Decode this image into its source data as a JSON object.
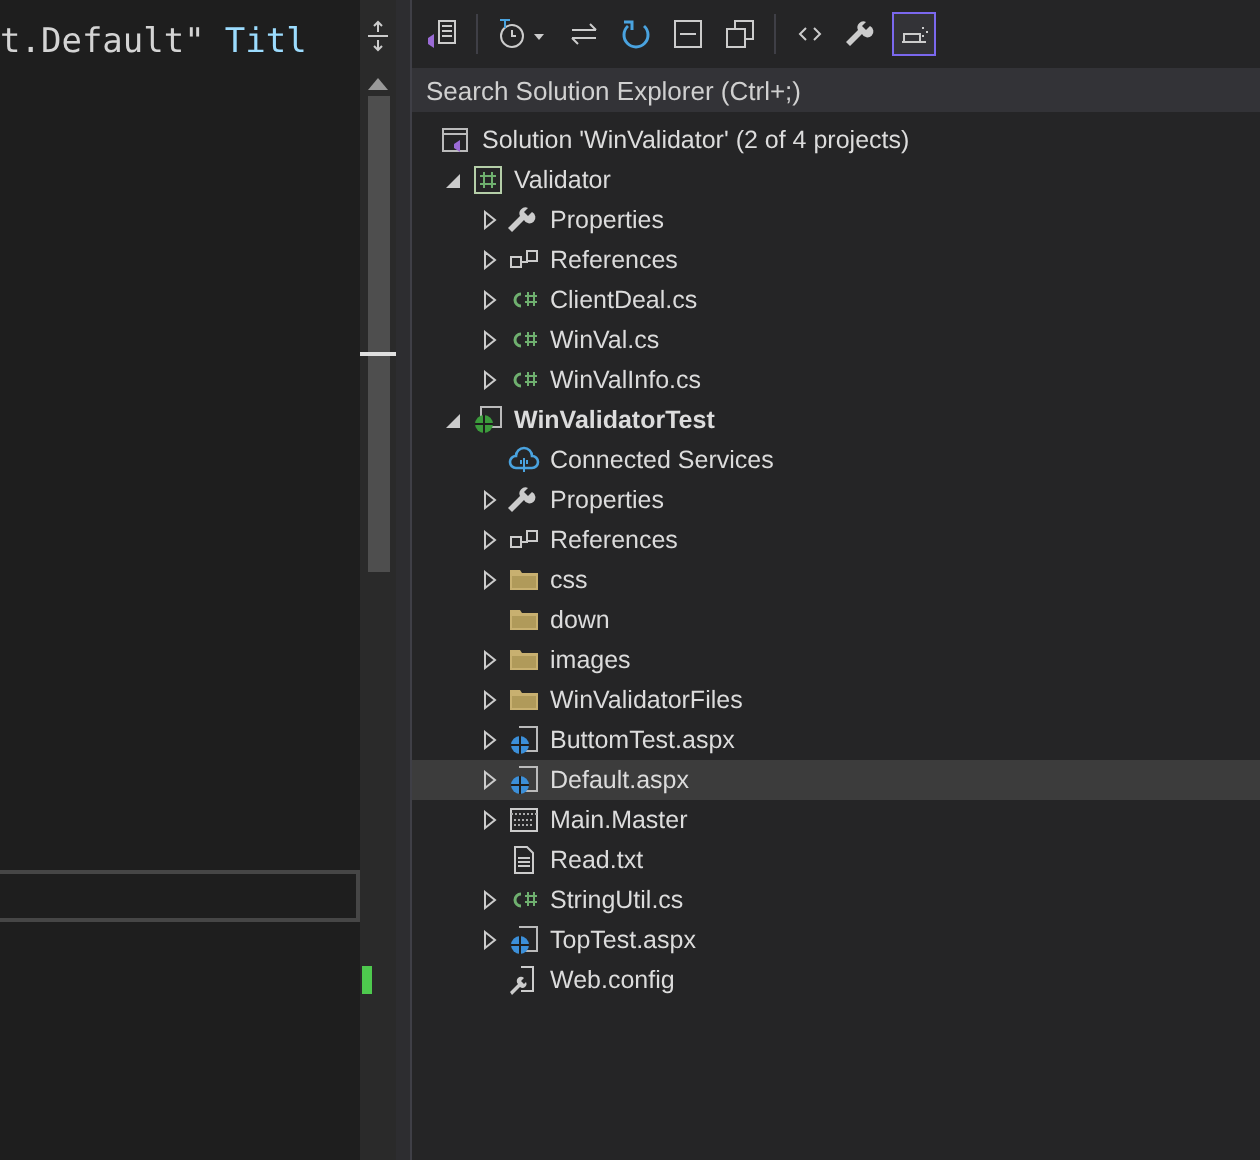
{
  "editor": {
    "code_line": [
      {
        "kind": "plain",
        "text": "t.Default\""
      },
      {
        "kind": "attribute",
        "text": "Titl"
      }
    ]
  },
  "solution_explorer": {
    "search": {
      "placeholder": "Search Solution Explorer (Ctrl+;)"
    },
    "toolbar": [
      {
        "kind": "home",
        "selected": false
      },
      {
        "kind": "history",
        "selected": false
      },
      {
        "kind": "sync",
        "selected": false
      },
      {
        "kind": "refresh",
        "selected": false
      },
      {
        "kind": "collapse",
        "selected": false
      },
      {
        "kind": "copies",
        "selected": false
      },
      {
        "kind": "code",
        "selected": false
      },
      {
        "kind": "wrench",
        "selected": false
      },
      {
        "kind": "preview",
        "selected": true
      }
    ],
    "tree": [
      {
        "label": "Solution 'WinValidator' (2 of 4 projects)",
        "kind": "solution",
        "selected": false,
        "bold": false,
        "children": [
          {
            "label": "Validator",
            "kind": "csproject",
            "expanded": true,
            "selected": false,
            "bold": false,
            "children": [
              {
                "label": "Properties",
                "kind": "wrench",
                "expanded": false,
                "selected": false,
                "bold": false
              },
              {
                "label": "References",
                "kind": "references",
                "expanded": false,
                "selected": false,
                "bold": false
              },
              {
                "label": "ClientDeal.cs",
                "kind": "csharp",
                "expanded": false,
                "selected": false,
                "bold": false
              },
              {
                "label": "WinVal.cs",
                "kind": "csharp",
                "expanded": false,
                "selected": false,
                "bold": false
              },
              {
                "label": "WinValInfo.cs",
                "kind": "csharp",
                "expanded": false,
                "selected": false,
                "bold": false
              }
            ]
          },
          {
            "label": "WinValidatorTest",
            "kind": "webproject",
            "expanded": true,
            "selected": false,
            "bold": true,
            "children": [
              {
                "label": "Connected Services",
                "kind": "connected",
                "selected": false,
                "bold": false
              },
              {
                "label": "Properties",
                "kind": "wrench",
                "expanded": false,
                "selected": false,
                "bold": false
              },
              {
                "label": "References",
                "kind": "references",
                "expanded": false,
                "selected": false,
                "bold": false
              },
              {
                "label": "css",
                "kind": "folder",
                "expanded": false,
                "selected": false,
                "bold": false
              },
              {
                "label": "down",
                "kind": "folder",
                "selected": false,
                "bold": false
              },
              {
                "label": "images",
                "kind": "folder",
                "expanded": false,
                "selected": false,
                "bold": false
              },
              {
                "label": "WinValidatorFiles",
                "kind": "folder",
                "expanded": false,
                "selected": false,
                "bold": false
              },
              {
                "label": "ButtomTest.aspx",
                "kind": "aspx",
                "expanded": false,
                "selected": false,
                "bold": false
              },
              {
                "label": "Default.aspx",
                "kind": "aspx",
                "expanded": false,
                "selected": true,
                "bold": false
              },
              {
                "label": "Main.Master",
                "kind": "master",
                "expanded": false,
                "selected": false,
                "bold": false
              },
              {
                "label": "Read.txt",
                "kind": "text",
                "selected": false,
                "bold": false
              },
              {
                "label": "StringUtil.cs",
                "kind": "csharp",
                "expanded": false,
                "selected": false,
                "bold": false
              },
              {
                "label": "TopTest.aspx",
                "kind": "aspx",
                "expanded": false,
                "selected": false,
                "bold": false
              },
              {
                "label": "Web.config",
                "kind": "config",
                "selected": false,
                "bold": false
              }
            ]
          }
        ]
      }
    ]
  }
}
